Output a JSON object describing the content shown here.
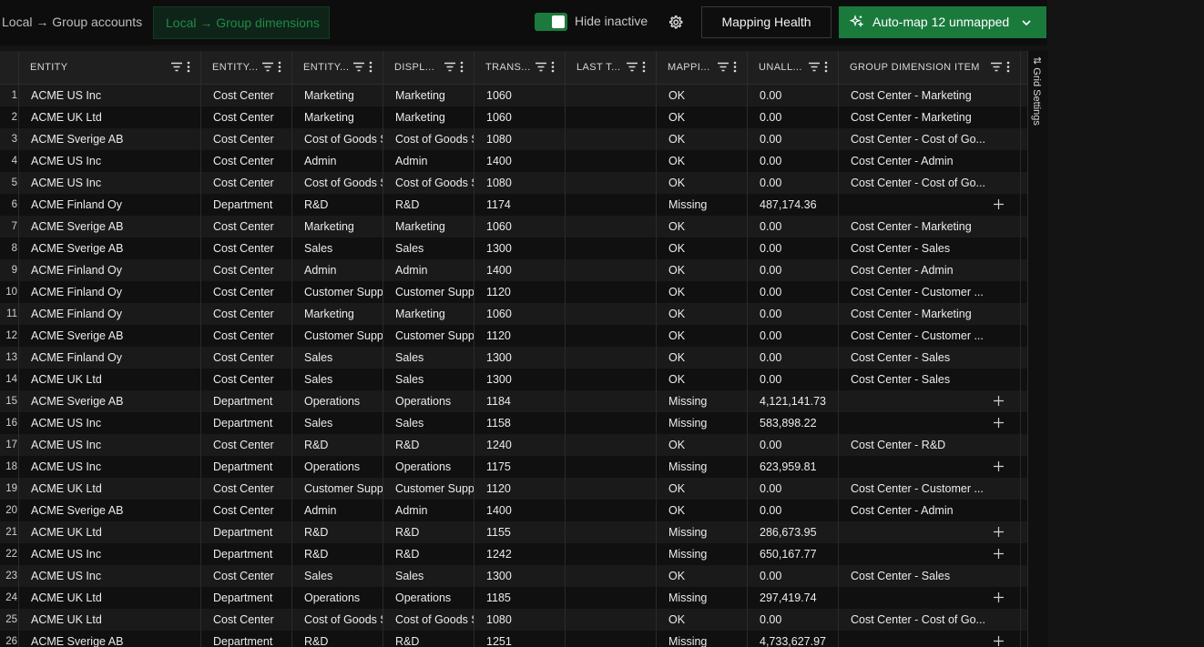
{
  "tabs": [
    {
      "label": "Local → Group accounts",
      "active": false
    },
    {
      "label": "Local → Group dimensions",
      "active": true
    }
  ],
  "toolbar": {
    "hide_inactive_label": "Hide inactive",
    "hide_inactive_on": true,
    "settings_icon": "gear-icon",
    "mapping_health_label": "Mapping Health",
    "automap_label": "Auto-map 12 unmapped",
    "automap_icon": "sparkles-icon",
    "automap_chevron_icon": "chevron-down-icon"
  },
  "colors": {
    "accent": "#1a7a3c",
    "background": "#141414",
    "row_odd": "#1a1a1a",
    "row_even": "#101010"
  },
  "side_panel": {
    "label": "Grid Settings",
    "icon": "grid-settings-icon"
  },
  "grid": {
    "columns": [
      {
        "key": "num",
        "label": ""
      },
      {
        "key": "entity",
        "label": "ENTITY"
      },
      {
        "key": "type",
        "label": "ENTITY..."
      },
      {
        "key": "name",
        "label": "ENTITY..."
      },
      {
        "key": "display",
        "label": "DISPL..."
      },
      {
        "key": "trans",
        "label": "TRANS..."
      },
      {
        "key": "last",
        "label": "LAST T..."
      },
      {
        "key": "mapping",
        "label": "MAPPI..."
      },
      {
        "key": "unall",
        "label": "UNALL..."
      },
      {
        "key": "group",
        "label": "GROUP DIMENSION ITEM"
      }
    ],
    "rows": [
      {
        "num": "1",
        "entity": "ACME US Inc",
        "type": "Cost Center",
        "name": "Marketing",
        "display": "Marketing",
        "trans": "1060",
        "last": "",
        "mapping": "OK",
        "unall": "0.00",
        "group": "Cost Center - Marketing"
      },
      {
        "num": "2",
        "entity": "ACME UK Ltd",
        "type": "Cost Center",
        "name": "Marketing",
        "display": "Marketing",
        "trans": "1060",
        "last": "",
        "mapping": "OK",
        "unall": "0.00",
        "group": "Cost Center - Marketing"
      },
      {
        "num": "3",
        "entity": "ACME Sverige AB",
        "type": "Cost Center",
        "name": "Cost of Goods Sold",
        "display": "Cost of Goods Sold",
        "trans": "1080",
        "last": "",
        "mapping": "OK",
        "unall": "0.00",
        "group": "Cost Center - Cost of Go..."
      },
      {
        "num": "4",
        "entity": "ACME US Inc",
        "type": "Cost Center",
        "name": "Admin",
        "display": "Admin",
        "trans": "1400",
        "last": "",
        "mapping": "OK",
        "unall": "0.00",
        "group": "Cost Center - Admin"
      },
      {
        "num": "5",
        "entity": "ACME US Inc",
        "type": "Cost Center",
        "name": "Cost of Goods Sold",
        "display": "Cost of Goods Sold",
        "trans": "1080",
        "last": "",
        "mapping": "OK",
        "unall": "0.00",
        "group": "Cost Center - Cost of Go..."
      },
      {
        "num": "6",
        "entity": "ACME Finland Oy",
        "type": "Department",
        "name": "R&D",
        "display": "R&D",
        "trans": "1174",
        "last": "",
        "mapping": "Missing",
        "unall": "487,174.36",
        "group": ""
      },
      {
        "num": "7",
        "entity": "ACME Sverige AB",
        "type": "Cost Center",
        "name": "Marketing",
        "display": "Marketing",
        "trans": "1060",
        "last": "",
        "mapping": "OK",
        "unall": "0.00",
        "group": "Cost Center - Marketing"
      },
      {
        "num": "8",
        "entity": "ACME Sverige AB",
        "type": "Cost Center",
        "name": "Sales",
        "display": "Sales",
        "trans": "1300",
        "last": "",
        "mapping": "OK",
        "unall": "0.00",
        "group": "Cost Center - Sales"
      },
      {
        "num": "9",
        "entity": "ACME Finland Oy",
        "type": "Cost Center",
        "name": "Admin",
        "display": "Admin",
        "trans": "1400",
        "last": "",
        "mapping": "OK",
        "unall": "0.00",
        "group": "Cost Center - Admin"
      },
      {
        "num": "10",
        "entity": "ACME Finland Oy",
        "type": "Cost Center",
        "name": "Customer Support",
        "display": "Customer Support",
        "trans": "1120",
        "last": "",
        "mapping": "OK",
        "unall": "0.00",
        "group": "Cost Center - Customer ..."
      },
      {
        "num": "11",
        "entity": "ACME Finland Oy",
        "type": "Cost Center",
        "name": "Marketing",
        "display": "Marketing",
        "trans": "1060",
        "last": "",
        "mapping": "OK",
        "unall": "0.00",
        "group": "Cost Center - Marketing"
      },
      {
        "num": "12",
        "entity": "ACME Sverige AB",
        "type": "Cost Center",
        "name": "Customer Support",
        "display": "Customer Support",
        "trans": "1120",
        "last": "",
        "mapping": "OK",
        "unall": "0.00",
        "group": "Cost Center - Customer ..."
      },
      {
        "num": "13",
        "entity": "ACME Finland Oy",
        "type": "Cost Center",
        "name": "Sales",
        "display": "Sales",
        "trans": "1300",
        "last": "",
        "mapping": "OK",
        "unall": "0.00",
        "group": "Cost Center - Sales"
      },
      {
        "num": "14",
        "entity": "ACME UK Ltd",
        "type": "Cost Center",
        "name": "Sales",
        "display": "Sales",
        "trans": "1300",
        "last": "",
        "mapping": "OK",
        "unall": "0.00",
        "group": "Cost Center - Sales"
      },
      {
        "num": "15",
        "entity": "ACME Sverige AB",
        "type": "Department",
        "name": "Operations",
        "display": "Operations",
        "trans": "1184",
        "last": "",
        "mapping": "Missing",
        "unall": "4,121,141.73",
        "group": ""
      },
      {
        "num": "16",
        "entity": "ACME US Inc",
        "type": "Department",
        "name": "Sales",
        "display": "Sales",
        "trans": "1158",
        "last": "",
        "mapping": "Missing",
        "unall": "583,898.22",
        "group": ""
      },
      {
        "num": "17",
        "entity": "ACME US Inc",
        "type": "Cost Center",
        "name": "R&D",
        "display": "R&D",
        "trans": "1240",
        "last": "",
        "mapping": "OK",
        "unall": "0.00",
        "group": "Cost Center - R&D"
      },
      {
        "num": "18",
        "entity": "ACME US Inc",
        "type": "Department",
        "name": "Operations",
        "display": "Operations",
        "trans": "1175",
        "last": "",
        "mapping": "Missing",
        "unall": "623,959.81",
        "group": ""
      },
      {
        "num": "19",
        "entity": "ACME UK Ltd",
        "type": "Cost Center",
        "name": "Customer Support",
        "display": "Customer Support",
        "trans": "1120",
        "last": "",
        "mapping": "OK",
        "unall": "0.00",
        "group": "Cost Center - Customer ..."
      },
      {
        "num": "20",
        "entity": "ACME Sverige AB",
        "type": "Cost Center",
        "name": "Admin",
        "display": "Admin",
        "trans": "1400",
        "last": "",
        "mapping": "OK",
        "unall": "0.00",
        "group": "Cost Center - Admin"
      },
      {
        "num": "21",
        "entity": "ACME UK Ltd",
        "type": "Department",
        "name": "R&D",
        "display": "R&D",
        "trans": "1155",
        "last": "",
        "mapping": "Missing",
        "unall": "286,673.95",
        "group": ""
      },
      {
        "num": "22",
        "entity": "ACME US Inc",
        "type": "Department",
        "name": "R&D",
        "display": "R&D",
        "trans": "1242",
        "last": "",
        "mapping": "Missing",
        "unall": "650,167.77",
        "group": ""
      },
      {
        "num": "23",
        "entity": "ACME US Inc",
        "type": "Cost Center",
        "name": "Sales",
        "display": "Sales",
        "trans": "1300",
        "last": "",
        "mapping": "OK",
        "unall": "0.00",
        "group": "Cost Center - Sales"
      },
      {
        "num": "24",
        "entity": "ACME UK Ltd",
        "type": "Department",
        "name": "Operations",
        "display": "Operations",
        "trans": "1185",
        "last": "",
        "mapping": "Missing",
        "unall": "297,419.74",
        "group": ""
      },
      {
        "num": "25",
        "entity": "ACME UK Ltd",
        "type": "Cost Center",
        "name": "Cost of Goods Sold",
        "display": "Cost of Goods Sold",
        "trans": "1080",
        "last": "",
        "mapping": "OK",
        "unall": "0.00",
        "group": "Cost Center - Cost of Go..."
      },
      {
        "num": "26",
        "entity": "ACME Sverige AB",
        "type": "Department",
        "name": "R&D",
        "display": "R&D",
        "trans": "1251",
        "last": "",
        "mapping": "Missing",
        "unall": "4,733,627.97",
        "group": ""
      }
    ]
  }
}
